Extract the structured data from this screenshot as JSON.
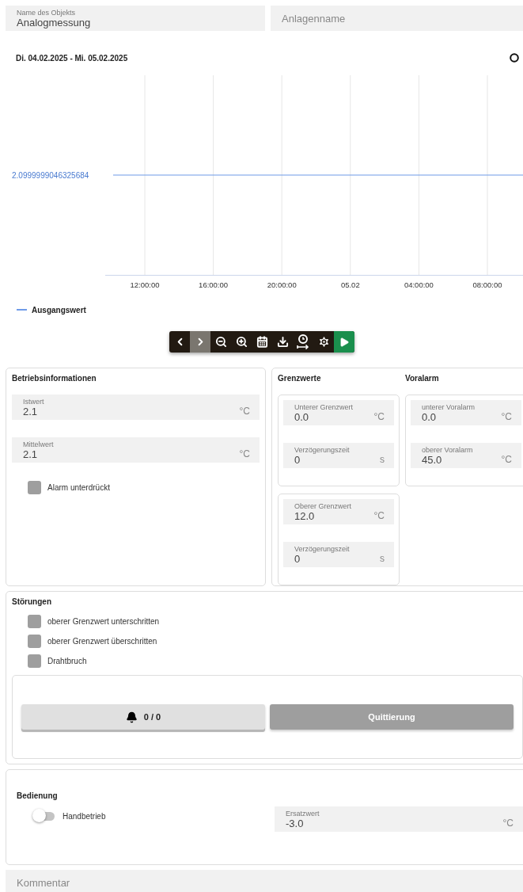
{
  "header_fields": [
    {
      "label": "Name des Objekts",
      "value": "Analogmessung"
    },
    {
      "placeholder": "Anlagenname"
    }
  ],
  "chart": {
    "date_range": "Di. 04.02.2025 - Mi. 05.02.2025",
    "value_label": "2.0999999046325684",
    "x_labels": [
      "12:00:00",
      "16:00:00",
      "20:00:00",
      "05.02",
      "04:00:00",
      "08:00:00"
    ],
    "legend": [
      {
        "name": "Ausgangswert",
        "color": "#6f9be8"
      }
    ]
  },
  "toolbar": [
    {
      "kind": "prev",
      "active": false
    },
    {
      "kind": "next",
      "active": true
    },
    {
      "kind": "zoom-out",
      "active": false
    },
    {
      "kind": "zoom-in",
      "active": false
    },
    {
      "kind": "calendar",
      "active": false
    },
    {
      "kind": "download",
      "active": false
    },
    {
      "kind": "time-range",
      "active": false
    },
    {
      "kind": "settings",
      "active": false
    },
    {
      "kind": "play",
      "active": false
    }
  ],
  "betriebsinformationen": {
    "title": "Betriebsinformationen",
    "fields": [
      {
        "label": "Istwert",
        "value": "2.1",
        "unit": "°C"
      },
      {
        "label": "Mittelwert",
        "value": "2.1",
        "unit": "°C"
      }
    ],
    "checkbox": {
      "label": "Alarm unterdrückt",
      "checked": false
    }
  },
  "grenzwerte": {
    "title": "Grenzwerte",
    "groups": [
      [
        {
          "label": "Unterer Grenzwert",
          "value": "0.0",
          "unit": "°C"
        },
        {
          "label": "Verzögerungszeit",
          "value": "0",
          "unit": "s"
        }
      ],
      [
        {
          "label": "Oberer Grenzwert",
          "value": "12.0",
          "unit": "°C"
        },
        {
          "label": "Verzögerungszeit",
          "value": "0",
          "unit": "s"
        }
      ]
    ]
  },
  "voralarm": {
    "title": "Voralarm",
    "fields": [
      {
        "label": "unterer Voralarm",
        "value": "0.0",
        "unit": "°C"
      },
      {
        "label": "oberer Voralarm",
        "value": "45.0",
        "unit": "°C"
      }
    ]
  },
  "stoerungen": {
    "title": "Störungen",
    "items": [
      {
        "label": "oberer Grenzwert unterschritten",
        "checked": false
      },
      {
        "label": "oberer Grenzwert überschritten",
        "checked": false
      },
      {
        "label": "Drahtbruch",
        "checked": false
      }
    ],
    "alarm_count": "0 / 0",
    "acknowledge": "Quittierung"
  },
  "bedienung": {
    "title": "Bedienung",
    "toggle": {
      "label": "Handbetrieb",
      "on": false
    },
    "field": {
      "label": "Ersatzwert",
      "value": "-3.0",
      "unit": "°C"
    }
  },
  "comment": {
    "placeholder": "Kommentar"
  }
}
